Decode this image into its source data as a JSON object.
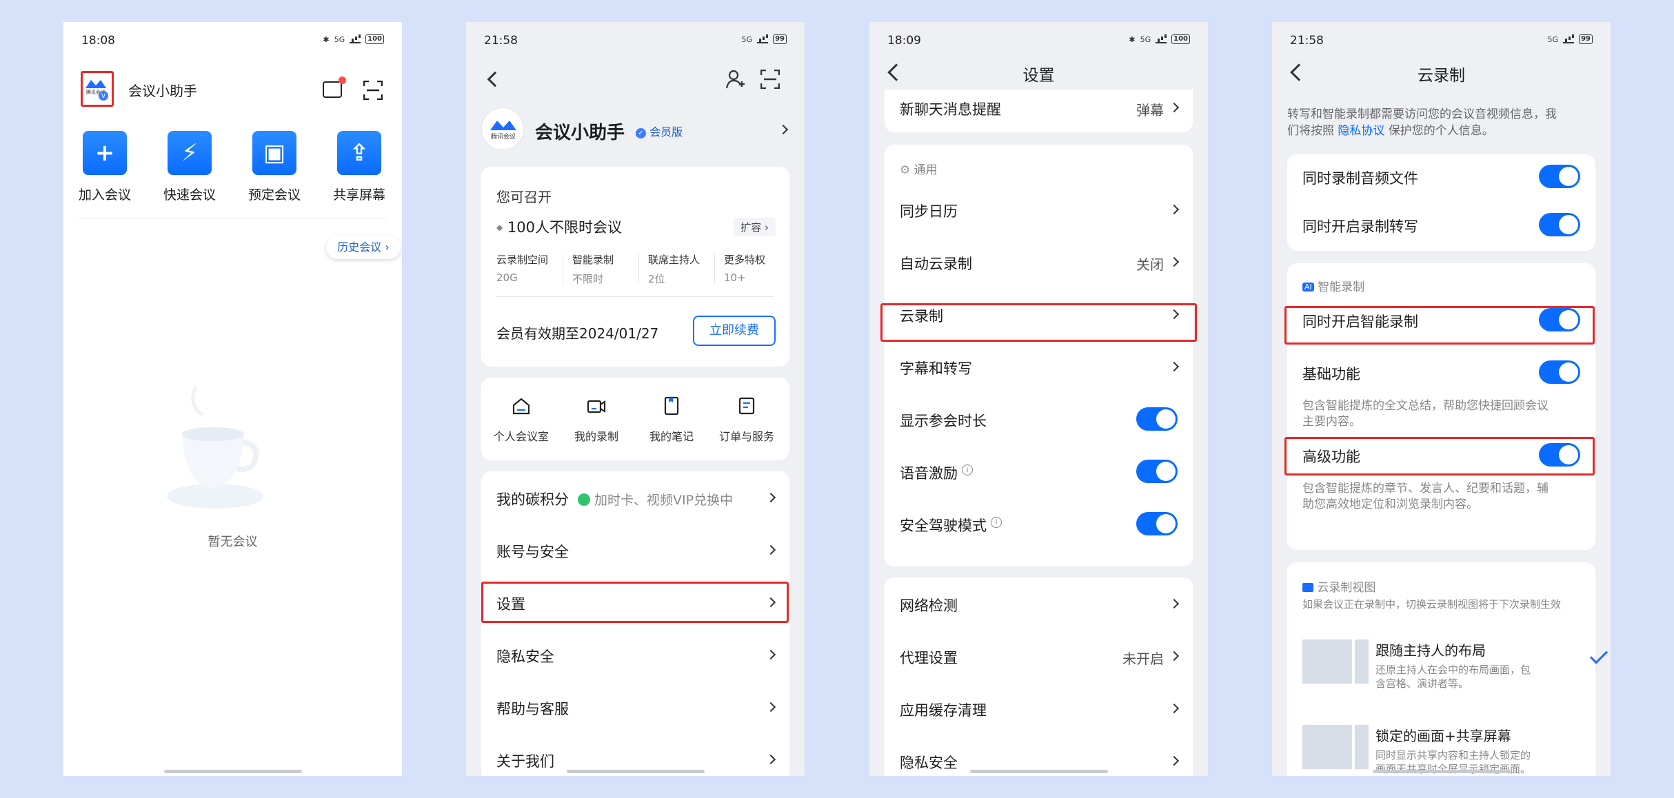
{
  "phone1": {
    "status": {
      "time": "18:08",
      "battery": "100",
      "net": "5G"
    },
    "app_name": "会议小助手",
    "logo_text": "腾讯会议",
    "quick_actions": [
      {
        "icon": "plus-icon",
        "glyph": "+",
        "label": "加入会议"
      },
      {
        "icon": "lightning-icon",
        "glyph": "⚡",
        "label": "快速会议"
      },
      {
        "icon": "calendar-icon",
        "glyph": "▣",
        "label": "预定会议"
      },
      {
        "icon": "share-screen-icon",
        "glyph": "⇪",
        "label": "共享屏幕"
      }
    ],
    "history_button": "历史会议 ›",
    "empty_text": "暂无会议"
  },
  "phone2": {
    "status": {
      "time": "21:58",
      "battery": "99",
      "net": "5G"
    },
    "user_name": "会议小助手",
    "logo_text": "腾讯会议",
    "member_badge": "会员版",
    "plan": {
      "heading": "您可召开",
      "meeting": "100人不限时会议",
      "expand": "扩容",
      "stats": [
        {
          "label": "云录制空间",
          "value": "20G"
        },
        {
          "label": "智能录制",
          "value": "不限时"
        },
        {
          "label": "联席主持人",
          "value": "2位"
        },
        {
          "label": "更多特权",
          "value": "10+"
        }
      ],
      "expiry": "会员有效期至2024/01/27",
      "renew": "立即续费"
    },
    "shortcuts": [
      {
        "icon": "house-icon",
        "label": "个人会议室"
      },
      {
        "icon": "video-record-icon",
        "label": "我的录制"
      },
      {
        "icon": "note-icon",
        "label": "我的笔记"
      },
      {
        "icon": "order-icon",
        "label": "订单与服务"
      }
    ],
    "carbon": {
      "label": "我的碳积分",
      "promo": "加时卡、视频VIP兑换中"
    },
    "menu": [
      "账号与安全",
      "设置",
      "隐私安全",
      "帮助与客服",
      "关于我们"
    ]
  },
  "phone3": {
    "status": {
      "time": "18:09",
      "battery": "100",
      "net": "5G"
    },
    "title": "设置",
    "top_row": {
      "label": "新聊天消息提醒",
      "value": "弹幕"
    },
    "section": "通用",
    "rows": [
      {
        "label": "同步日历",
        "value": ""
      },
      {
        "label": "自动云录制",
        "value": "关闭"
      },
      {
        "label": "云录制",
        "value": ""
      },
      {
        "label": "字幕和转写",
        "value": ""
      },
      {
        "label": "显示参会时长",
        "value": ""
      },
      {
        "label": "语音激励",
        "value": ""
      },
      {
        "label": "安全驾驶模式",
        "value": ""
      }
    ],
    "rows2": [
      {
        "label": "网络检测",
        "value": ""
      },
      {
        "label": "代理设置",
        "value": "未开启"
      },
      {
        "label": "应用缓存清理",
        "value": ""
      },
      {
        "label": "隐私安全",
        "value": ""
      }
    ]
  },
  "phone4": {
    "status": {
      "time": "21:58",
      "battery": "99",
      "net": "5G"
    },
    "title": "云录制",
    "intro_1": "转写和智能录制都需要访问您的会议音视频信息，我",
    "intro_2a": "们将按照",
    "intro_link": "隐私协议",
    "intro_2b": "保护您的个人信息。",
    "toggles_1": [
      "同时录制音频文件",
      "同时开启录制转写"
    ],
    "ai_section": "智能录制",
    "ai_badge": "AI",
    "smart_toggle": "同时开启智能录制",
    "basic": {
      "label": "基础功能",
      "desc_1": "包含智能提炼的全文总结，帮助您快捷回顾会议",
      "desc_2": "主要内容。"
    },
    "advanced": {
      "label": "高级功能",
      "desc_1": "包含智能提炼的章节、发言人、纪要和话题，辅",
      "desc_2": "助您高效地定位和浏览录制内容。"
    },
    "view_section": "云录制视图",
    "view_note": "如果会议正在录制中，切换云录制视图将于下次录制生效",
    "views": [
      {
        "title": "跟随主持人的布局",
        "desc_1": "还原主持人在会中的布局画面，包",
        "desc_2": "含宫格、演讲者等。"
      },
      {
        "title": "锁定的画面+共享屏幕",
        "desc_1": "同时显示共享内容和主持人锁定的",
        "desc_2": "画面无共享时全屏显示锁定画面。"
      }
    ]
  }
}
